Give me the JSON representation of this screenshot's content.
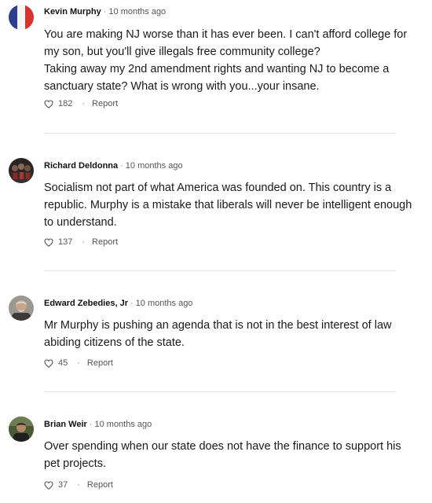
{
  "comments": [
    {
      "author": "Kevin Murphy",
      "sep": "·",
      "time": "10 months ago",
      "lines": [
        "You are making NJ worse than it has ever been. I can't afford college for my son, but you'll give illegals free community college?",
        "Taking away my 2nd amendment rights and wanting NJ to become a sanctuary state? What is wrong with you...your insane."
      ],
      "likes": "182",
      "dot": "·",
      "report": "Report",
      "avatar_icon": "flag-avatar"
    },
    {
      "author": "Richard Deldonna",
      "sep": "·",
      "time": "10 months ago",
      "lines": [
        "Socialism not part of what America was founded on. This country is a republic. Murphy is a mistake that liberals will never be intelligent enough to understand."
      ],
      "likes": "137",
      "dot": "·",
      "report": "Report",
      "avatar_icon": "group-photo-avatar"
    },
    {
      "author": "Edward Zebedies, Jr",
      "sep": "·",
      "time": "10 months ago",
      "lines": [
        "Mr Murphy is pushing an agenda that is not in the best interest of law abiding citizens of the state."
      ],
      "likes": "45",
      "dot": "·",
      "report": "Report",
      "avatar_icon": "portrait-avatar"
    },
    {
      "author": "Brian Weir",
      "sep": "·",
      "time": "10 months ago",
      "lines": [
        "Over spending when our state does not have the finance to support his pet projects."
      ],
      "likes": "37",
      "dot": "·",
      "report": "Report",
      "avatar_icon": "outdoor-avatar"
    }
  ],
  "colors": {
    "text": "#1a1a1a",
    "meta": "#555555",
    "divider": "#e3e3e3",
    "flag_blue": "#2b3f8c",
    "flag_red": "#d8312e"
  }
}
